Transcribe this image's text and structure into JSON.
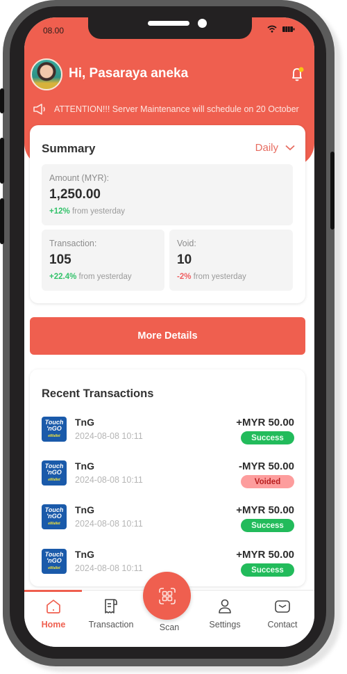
{
  "status_bar": {
    "time": "08.00",
    "icons": [
      "wifi-icon",
      "battery-icon"
    ]
  },
  "header": {
    "greeting": "Hi, Pasaraya aneka",
    "avatar": "user-avatar",
    "notification_icon": "bell-icon",
    "has_notification_dot": true
  },
  "announcement": {
    "icon": "megaphone-icon",
    "text": "ATTENTION!!! Server Maintenance will schedule on 20 October"
  },
  "summary": {
    "title": "Summary",
    "period": "Daily",
    "amount": {
      "label": "Amount (MYR):",
      "value": "1,250.00",
      "change": "+12%",
      "change_suffix": "from yesterday",
      "trend": "up"
    },
    "transaction": {
      "label": "Transaction:",
      "value": "105",
      "change": "+22.4%",
      "change_suffix": "from yesterday",
      "trend": "up"
    },
    "void": {
      "label": "Void:",
      "value": "10",
      "change": "-2%",
      "change_suffix": "from yesterday",
      "trend": "down"
    }
  },
  "more_details_label": "More Details",
  "recent": {
    "title": "Recent Transactions",
    "items": [
      {
        "logo_line1": "Touch",
        "logo_line2": "'nGO",
        "logo_line3": "eWallet",
        "name": "TnG",
        "date": "2024-08-08 10:11",
        "amount": "+MYR 50.00",
        "status": "Success"
      },
      {
        "logo_line1": "Touch",
        "logo_line2": "'nGO",
        "logo_line3": "eWallet",
        "name": "TnG",
        "date": "2024-08-08 10:11",
        "amount": "-MYR 50.00",
        "status": "Voided"
      },
      {
        "logo_line1": "Touch",
        "logo_line2": "'nGO",
        "logo_line3": "eWallet",
        "name": "TnG",
        "date": "2024-08-08 10:11",
        "amount": "+MYR 50.00",
        "status": "Success"
      },
      {
        "logo_line1": "Touch",
        "logo_line2": "'nGO",
        "logo_line3": "eWallet",
        "name": "TnG",
        "date": "2024-08-08 10:11",
        "amount": "+MYR 50.00",
        "status": "Success"
      }
    ]
  },
  "tabbar": {
    "active": "Home",
    "tabs": [
      {
        "label": "Home",
        "icon": "home-icon"
      },
      {
        "label": "Transaction",
        "icon": "receipt-icon"
      },
      {
        "label": "Scan",
        "icon": "qr-scan-icon"
      },
      {
        "label": "Settings",
        "icon": "user-icon"
      },
      {
        "label": "Contact",
        "icon": "mail-icon"
      }
    ]
  },
  "colors": {
    "brand": "#ef5f4f",
    "success": "#22bb5b",
    "voided": "#fd9d9d",
    "positive": "#34c26b",
    "negative": "#ef5f62"
  }
}
